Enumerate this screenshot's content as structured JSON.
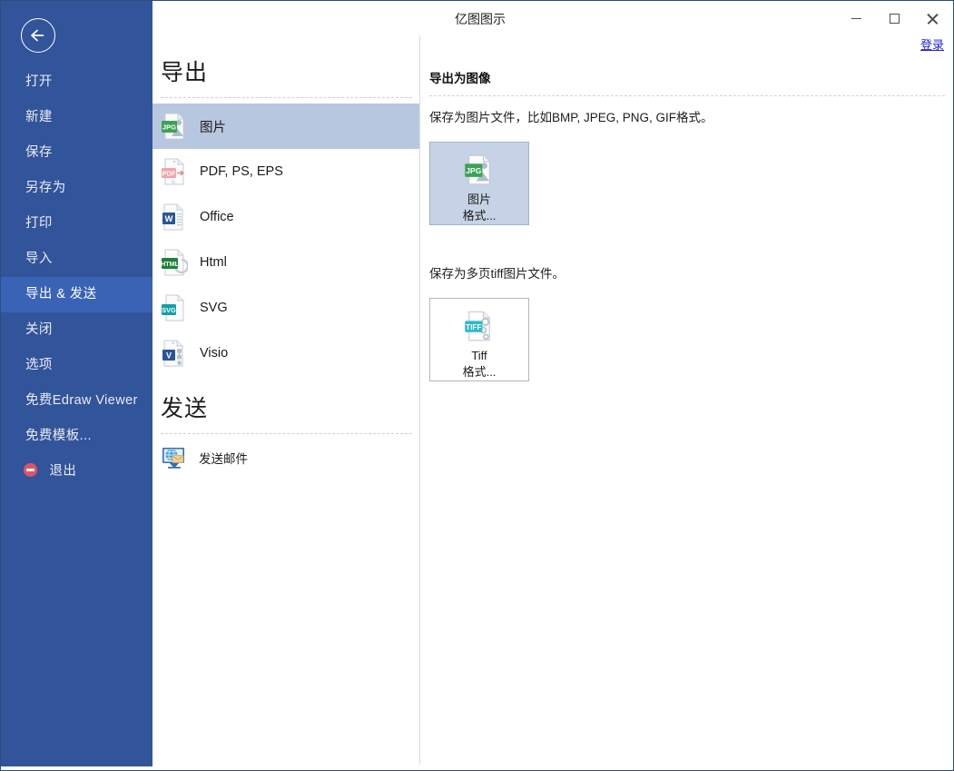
{
  "window": {
    "title": "亿图图示",
    "login_label": "登录",
    "controls": {
      "minimize": "minimize",
      "maximize": "maximize",
      "close": "close"
    }
  },
  "sidebar": {
    "back_label": "返回",
    "items": [
      {
        "label": "打开",
        "active": false,
        "icon": null
      },
      {
        "label": "新建",
        "active": false,
        "icon": null
      },
      {
        "label": "保存",
        "active": false,
        "icon": null
      },
      {
        "label": "另存为",
        "active": false,
        "icon": null
      },
      {
        "label": "打印",
        "active": false,
        "icon": null
      },
      {
        "label": "导入",
        "active": false,
        "icon": null
      },
      {
        "label": "导出 & 发送",
        "active": true,
        "icon": null
      },
      {
        "label": "关闭",
        "active": false,
        "icon": null
      },
      {
        "label": "选项",
        "active": false,
        "icon": null
      },
      {
        "label": "免费Edraw Viewer",
        "active": false,
        "icon": null
      },
      {
        "label": "免费模板...",
        "active": false,
        "icon": null
      },
      {
        "label": "退出",
        "active": false,
        "icon": "exit-icon"
      }
    ]
  },
  "middle": {
    "export_heading": "导出",
    "export_items": [
      {
        "label": "图片",
        "icon": "jpg-file-icon",
        "selected": true
      },
      {
        "label": "PDF, PS, EPS",
        "icon": "pdf-file-icon",
        "selected": false
      },
      {
        "label": "Office",
        "icon": "word-file-icon",
        "selected": false
      },
      {
        "label": "Html",
        "icon": "html-file-icon",
        "selected": false
      },
      {
        "label": "SVG",
        "icon": "svg-file-icon",
        "selected": false
      },
      {
        "label": "Visio",
        "icon": "visio-file-icon",
        "selected": false
      }
    ],
    "send_heading": "发送",
    "send_items": [
      {
        "label": "发送邮件",
        "icon": "send-mail-icon"
      }
    ]
  },
  "right": {
    "title": "导出为图像",
    "desc_image": "保存为图片文件，比如BMP, JPEG, PNG, GIF格式。",
    "card_image": {
      "line1": "图片",
      "line2": "格式...",
      "icon": "jpg-file-icon",
      "selected": true
    },
    "desc_tiff": "保存为多页tiff图片文件。",
    "card_tiff": {
      "line1": "Tiff",
      "line2": "格式...",
      "icon": "tiff-file-icon",
      "selected": false
    }
  },
  "colors": {
    "sidebar_bg": "#32549a",
    "sidebar_active": "#3a62b5",
    "selection_blue": "#b8c7e0",
    "card_selected": "#c6d3e6",
    "link_blue": "#2222dd",
    "window_border": "#2d4d7e"
  }
}
